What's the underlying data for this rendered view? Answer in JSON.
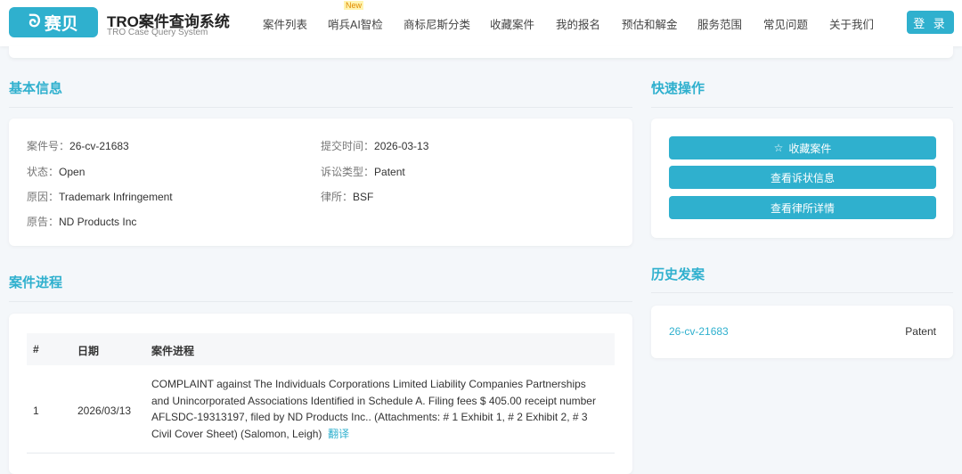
{
  "header": {
    "logo": "赛贝",
    "title": "TRO案件查询系统",
    "subtitle": "TRO Case Query System",
    "nav": [
      "案件列表",
      "哨兵AI智检",
      "商标尼斯分类",
      "收藏案件",
      "我的报名",
      "预估和解金",
      "服务范围",
      "常见问题",
      "关于我们"
    ],
    "new_badge": "New",
    "login": "登 录"
  },
  "basic": {
    "title": "基本信息",
    "fields": [
      {
        "label": "案件号：",
        "value": "26-cv-21683"
      },
      {
        "label": "提交时间：",
        "value": "2026-03-13"
      },
      {
        "label": "状态：",
        "value": "Open"
      },
      {
        "label": "诉讼类型：",
        "value": "Patent"
      },
      {
        "label": "原因：",
        "value": "Trademark Infringement"
      },
      {
        "label": "律所：",
        "value": "BSF"
      },
      {
        "label": "原告：",
        "value": "ND Products Inc"
      }
    ]
  },
  "quick": {
    "title": "快速操作",
    "buttons": [
      "收藏案件",
      "查看诉状信息",
      "查看律所详情"
    ]
  },
  "history": {
    "title": "历史发案",
    "items": [
      {
        "case": "26-cv-21683",
        "type": "Patent"
      }
    ]
  },
  "progress": {
    "title": "案件进程",
    "headers": [
      "#",
      "日期",
      "案件进程"
    ],
    "rows": [
      {
        "no": "1",
        "date": "2026/03/13",
        "text": "COMPLAINT against The Individuals Corporations Limited Liability Companies Partnerships and Unincorporated Associations Identified in Schedule A. Filing fees $ 405.00 receipt number AFLSDC-19313197, filed by ND Products Inc.. (Attachments: # 1 Exhibit 1, # 2 Exhibit 2, # 3 Civil Cover Sheet) (Salomon, Leigh)",
        "translate": "翻译"
      }
    ]
  }
}
